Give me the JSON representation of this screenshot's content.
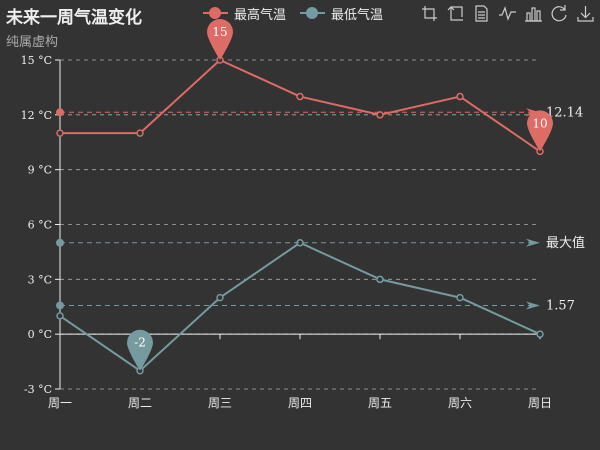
{
  "title": "未来一周气温变化",
  "subtitle": "纯属虚构",
  "legend": [
    "最高气温",
    "最低气温"
  ],
  "toolbox": [
    "zoom-icon",
    "zoom-reset-icon",
    "data-view-icon",
    "line-chart-icon",
    "bar-chart-icon",
    "restore-icon",
    "save-image-icon"
  ],
  "colors": {
    "background": "#333333",
    "max": "#dd6b66",
    "min": "#759aa0",
    "grid": "#aaaaaa",
    "text": "#eeeeee"
  },
  "chart_data": {
    "type": "line",
    "categories": [
      "周一",
      "周二",
      "周三",
      "周四",
      "周五",
      "周六",
      "周日"
    ],
    "series": [
      {
        "name": "最高气温",
        "values": [
          11,
          11,
          15,
          13,
          12,
          13,
          10
        ],
        "markPoints": [
          {
            "category": "周三",
            "value": 15,
            "label": "15"
          },
          {
            "category": "周日",
            "value": 10,
            "label": "10"
          }
        ],
        "markLine": {
          "value": 12.14,
          "label": "12.14"
        }
      },
      {
        "name": "最低气温",
        "values": [
          1,
          -2,
          2,
          5,
          3,
          2,
          0
        ],
        "markPoints": [
          {
            "category": "周二",
            "value": -2,
            "label": "-2"
          }
        ],
        "markLines": [
          {
            "value": 1.57,
            "label": "1.57"
          },
          {
            "value": 5,
            "label": "最大值"
          }
        ]
      }
    ],
    "yAxis": {
      "min": -3,
      "max": 15,
      "interval": 3,
      "unit": "°C",
      "ticks": [
        "-3 °C",
        "0 °C",
        "3 °C",
        "6 °C",
        "9 °C",
        "12 °C",
        "15 °C"
      ]
    },
    "grid": true,
    "legend_position": "top-center"
  }
}
